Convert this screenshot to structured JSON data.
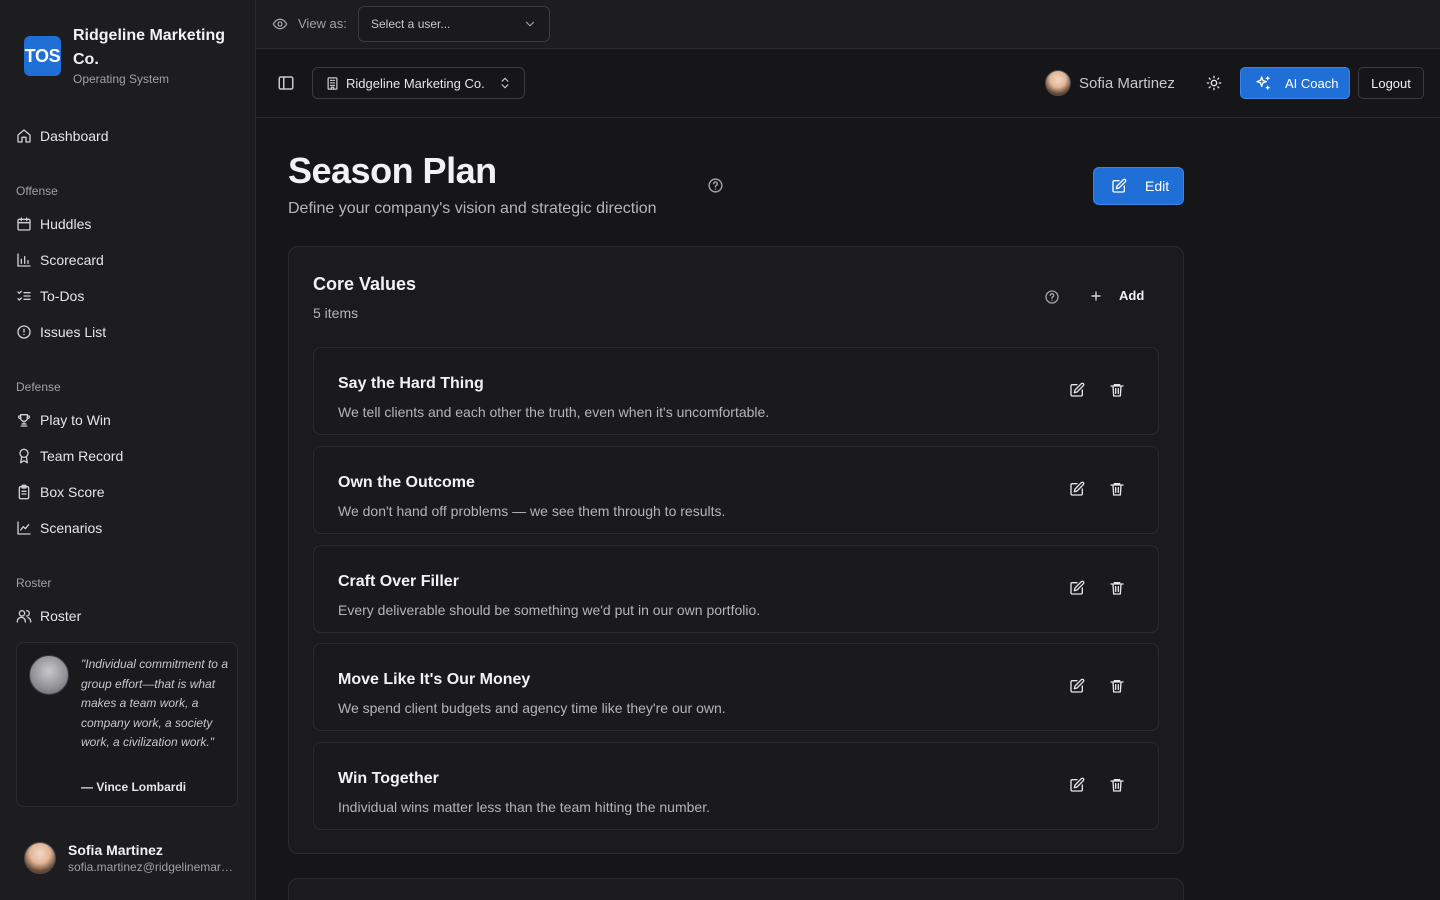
{
  "brand": {
    "logo": "TOS",
    "name": "Ridgeline Marketing Co.",
    "subtitle": "Operating System"
  },
  "nav": {
    "dashboard": "Dashboard",
    "sections": [
      {
        "label": "Offense",
        "items": [
          "Huddles",
          "Scorecard",
          "To-Dos",
          "Issues List"
        ]
      },
      {
        "label": "Defense",
        "items": [
          "Play to Win",
          "Team Record",
          "Box Score",
          "Scenarios"
        ]
      },
      {
        "label": "Roster",
        "items": [
          "Roster"
        ]
      }
    ]
  },
  "quote": {
    "text": "\"Individual commitment to a group effort—that is what makes a team work, a company work, a society work, a civilization work.\"",
    "author": "— Vince Lombardi"
  },
  "current_user": {
    "name": "Sofia Martinez",
    "email": "sofia.martinez@ridgelinemarketing.com"
  },
  "view_as": {
    "label": "View as:",
    "placeholder": "Select a user..."
  },
  "header": {
    "org": "Ridgeline Marketing Co.",
    "user_name": "Sofia Martinez",
    "coach_label": "AI Coach",
    "logout_label": "Logout"
  },
  "page": {
    "title": "Season Plan",
    "subtitle": "Define your company's vision and strategic direction",
    "edit_label": "Edit"
  },
  "core_values": {
    "title": "Core Values",
    "count": "5 items",
    "add_label": "Add",
    "items": [
      {
        "title": "Say the Hard Thing",
        "description": "We tell clients and each other the truth, even when it's uncomfortable."
      },
      {
        "title": "Own the Outcome",
        "description": "We don't hand off problems — we see them through to results."
      },
      {
        "title": "Craft Over Filler",
        "description": "Every deliverable should be something we'd put in our own portfolio."
      },
      {
        "title": "Move Like It's Our Money",
        "description": "We spend client budgets and agency time like they're our own."
      },
      {
        "title": "Win Together",
        "description": "Individual wins matter less than the team hitting the number."
      }
    ]
  },
  "colors": {
    "accent": "#1f6fd6",
    "background": "#161618",
    "sidebar": "#1d1d20"
  }
}
